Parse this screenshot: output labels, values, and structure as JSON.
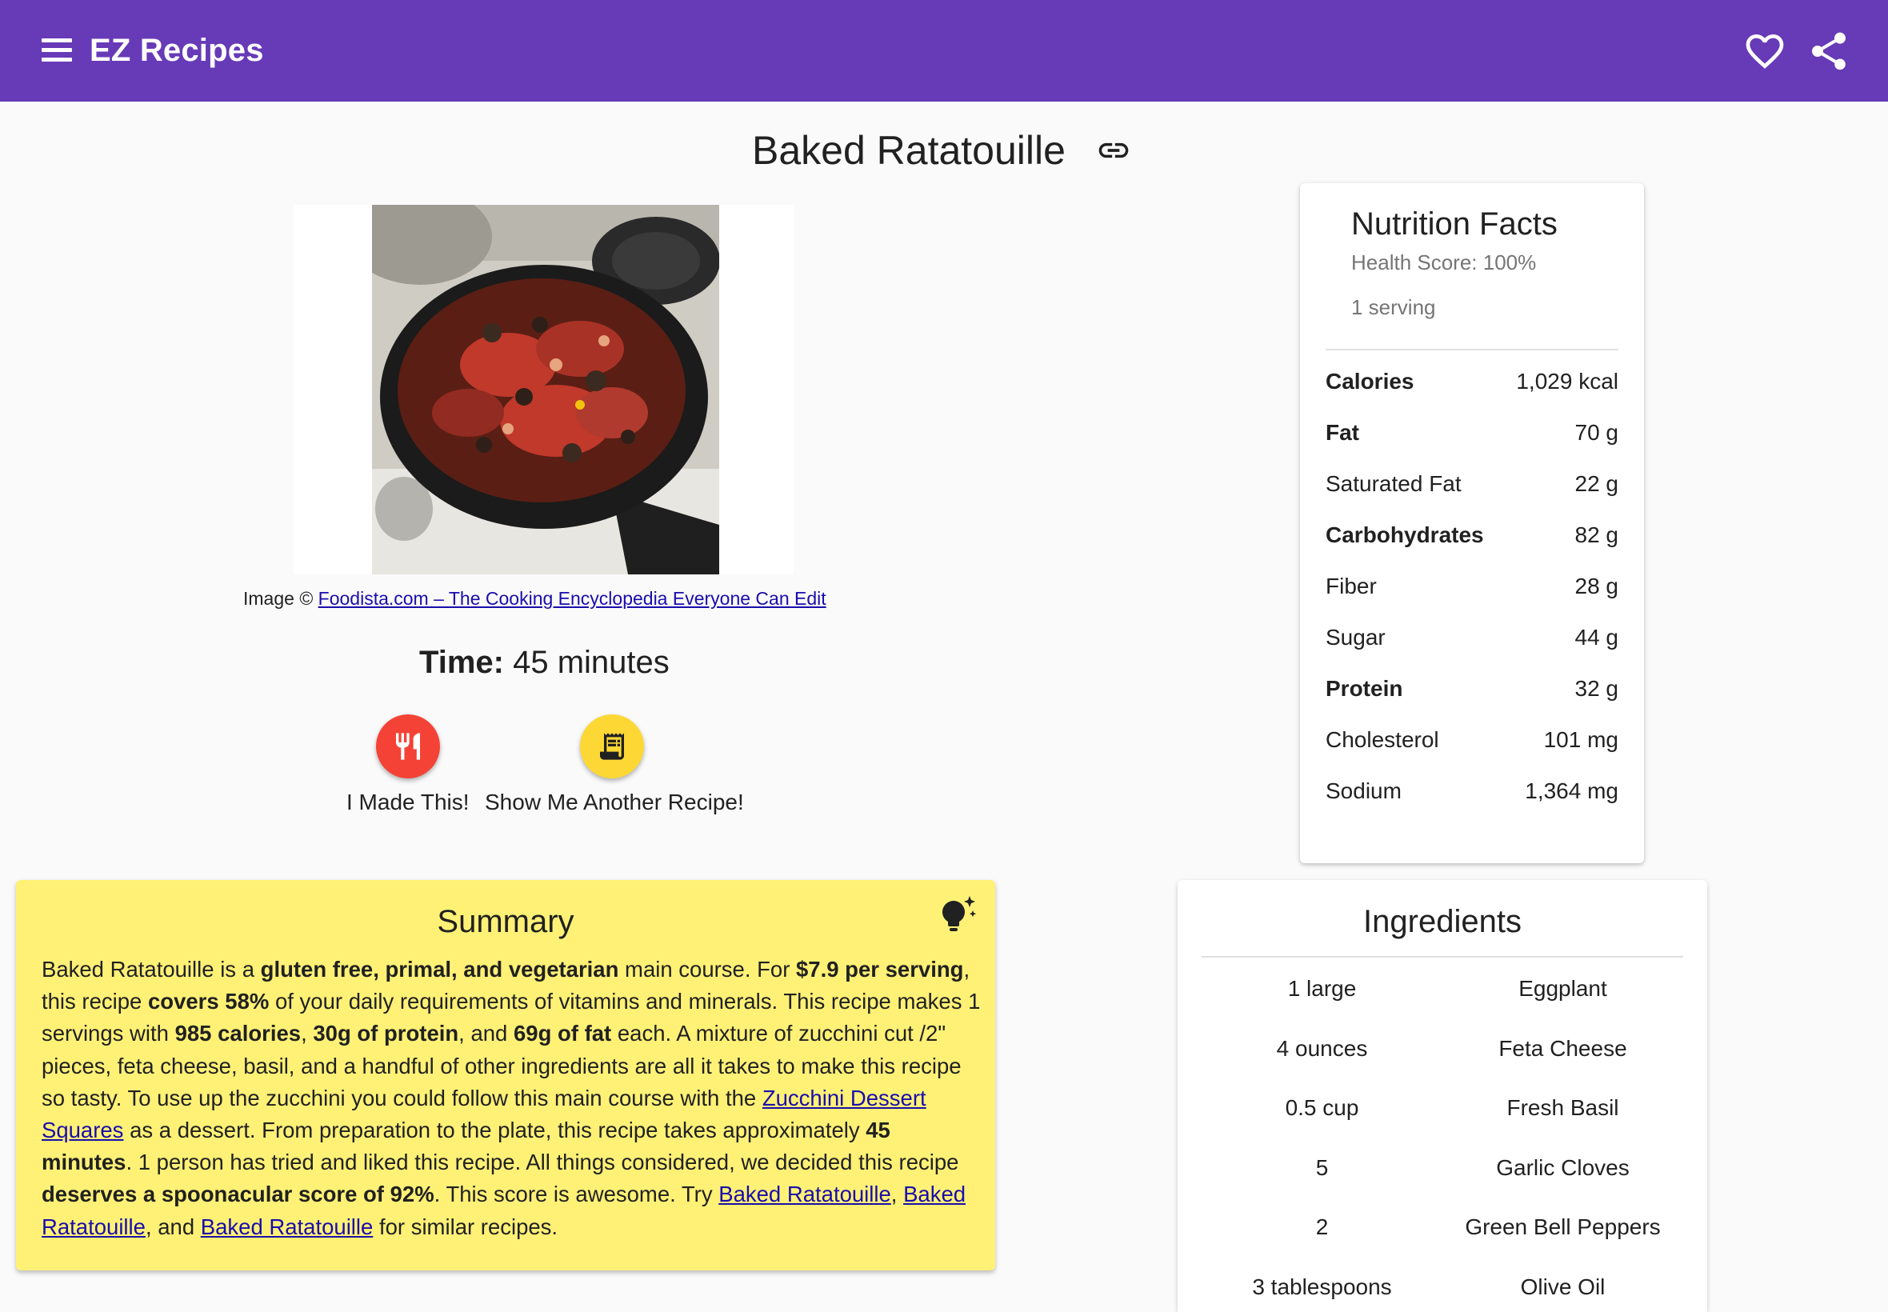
{
  "app": {
    "title": "EZ Recipes",
    "theme_color": "#673ab7"
  },
  "recipe": {
    "title": "Baked Ratatouille",
    "image_credit_prefix": "Image ©",
    "image_credit_link": "Foodista.com – The Cooking Encyclopedia Everyone Can Edit",
    "time_label": "Time:",
    "time_value": "45 minutes"
  },
  "actions": {
    "made_label": "I Made This!",
    "another_label": "Show Me Another Recipe!",
    "made_color": "#f44336",
    "another_color": "#fdd835"
  },
  "summary": {
    "title": "Summary",
    "card_color": "#fff176",
    "segments": [
      {
        "t": "Baked Ratatouille is a "
      },
      {
        "t": "gluten free, primal, and vegetarian",
        "b": true
      },
      {
        "t": " main course. For "
      },
      {
        "t": "$7.9 per serving",
        "b": true
      },
      {
        "t": ", this recipe "
      },
      {
        "t": "covers 58%",
        "b": true
      },
      {
        "t": " of your daily requirements of vitamins and minerals. This recipe makes 1 servings with "
      },
      {
        "t": "985 calories",
        "b": true
      },
      {
        "t": ", "
      },
      {
        "t": "30g of protein",
        "b": true
      },
      {
        "t": ", and "
      },
      {
        "t": "69g of fat",
        "b": true
      },
      {
        "t": " each. A mixture of zucchini cut /2\" pieces, feta cheese, basil, and a handful of other ingredients are all it takes to make this recipe so tasty. To use up the zucchini you could follow this main course with the "
      },
      {
        "t": "Zucchini Dessert Squares",
        "link": true
      },
      {
        "t": " as a dessert. From preparation to the plate, this recipe takes approximately "
      },
      {
        "t": "45 minutes",
        "b": true
      },
      {
        "t": ". 1 person has tried and liked this recipe. All things considered, we decided this recipe "
      },
      {
        "t": "deserves a spoonacular score of 92%",
        "b": true
      },
      {
        "t": ". This score is awesome. Try "
      },
      {
        "t": "Baked Ratatouille",
        "link": true
      },
      {
        "t": ", "
      },
      {
        "t": "Baked Ratatouille",
        "link": true
      },
      {
        "t": ", and "
      },
      {
        "t": "Baked Ratatouille",
        "link": true
      },
      {
        "t": " for similar recipes."
      }
    ]
  },
  "nutrition": {
    "title": "Nutrition Facts",
    "health_score": "Health Score: 100%",
    "servings": "1 serving",
    "rows": [
      {
        "label": "Calories",
        "value": "1,029 kcal",
        "bold": true
      },
      {
        "label": "Fat",
        "value": "70 g",
        "bold": true
      },
      {
        "label": "Saturated Fat",
        "value": "22 g",
        "bold": false
      },
      {
        "label": "Carbohydrates",
        "value": "82 g",
        "bold": true
      },
      {
        "label": "Fiber",
        "value": "28 g",
        "bold": false
      },
      {
        "label": "Sugar",
        "value": "44 g",
        "bold": false
      },
      {
        "label": "Protein",
        "value": "32 g",
        "bold": true
      },
      {
        "label": "Cholesterol",
        "value": "101 mg",
        "bold": false
      },
      {
        "label": "Sodium",
        "value": "1,364 mg",
        "bold": false
      }
    ]
  },
  "ingredients": {
    "title": "Ingredients",
    "items": [
      {
        "amount": "1 large",
        "name": "Eggplant"
      },
      {
        "amount": "4 ounces",
        "name": "Feta Cheese"
      },
      {
        "amount": "0.5 cup",
        "name": "Fresh Basil"
      },
      {
        "amount": "5",
        "name": "Garlic Cloves"
      },
      {
        "amount": "2",
        "name": "Green Bell Peppers"
      },
      {
        "amount": "3 tablespoons",
        "name": "Olive Oil"
      }
    ]
  }
}
